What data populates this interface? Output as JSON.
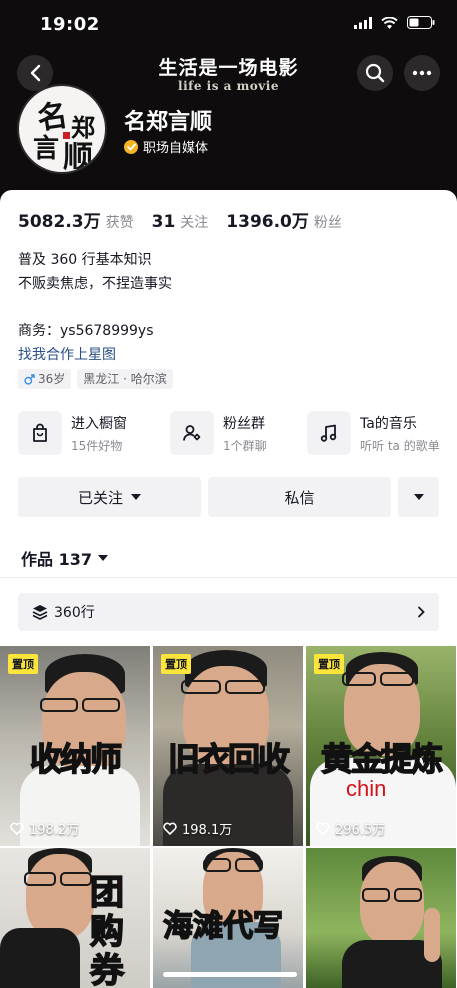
{
  "status_bar": {
    "time": "19:02"
  },
  "header": {
    "title": "生活是一场电影",
    "subtitle": "life is a movie"
  },
  "avatar": {
    "chars": [
      "名",
      "郑",
      "言",
      "顺"
    ]
  },
  "profile": {
    "name": "名郑言顺",
    "verification": "职场自媒体"
  },
  "stats": [
    {
      "value": "5082.3万",
      "label": "获赞"
    },
    {
      "value": "31",
      "label": "关注"
    },
    {
      "value": "1396.0万",
      "label": "粉丝"
    }
  ],
  "bio": {
    "line1": "普及 360 行基本知识",
    "line2": "不贩卖焦虑，不捏造事实",
    "business": "商务：ys5678999ys",
    "link": "找我合作上星图"
  },
  "tags": {
    "age": "36岁",
    "location": "黑龙江 · 哈尔滨"
  },
  "shortcuts": [
    {
      "title": "进入橱窗",
      "subtitle": "15件好物",
      "icon": "bag-icon"
    },
    {
      "title": "粉丝群",
      "subtitle": "1个群聊",
      "icon": "group-icon"
    },
    {
      "title": "Ta的音乐",
      "subtitle": "听听 ta 的歌单",
      "icon": "music-icon"
    }
  ],
  "actions": {
    "follow": "已关注",
    "message": "私信"
  },
  "works": {
    "label": "作品 137"
  },
  "collection": {
    "label": "360行"
  },
  "videos": [
    {
      "pinned": "置顶",
      "caption": "收纳师",
      "likes": "198.2万"
    },
    {
      "pinned": "置顶",
      "caption": "旧衣回收",
      "likes": "198.1万"
    },
    {
      "pinned": "置顶",
      "caption": "黄金提炼",
      "likes": "296.5万"
    },
    {
      "caption": "团购券"
    },
    {
      "caption": "海滩代写"
    },
    {
      "caption": ""
    }
  ],
  "colors": {
    "accent_gold": "#f4b323",
    "pin_yellow": "#fce53b",
    "caption_red": "#d3121a",
    "link_blue": "#2b4f86"
  }
}
